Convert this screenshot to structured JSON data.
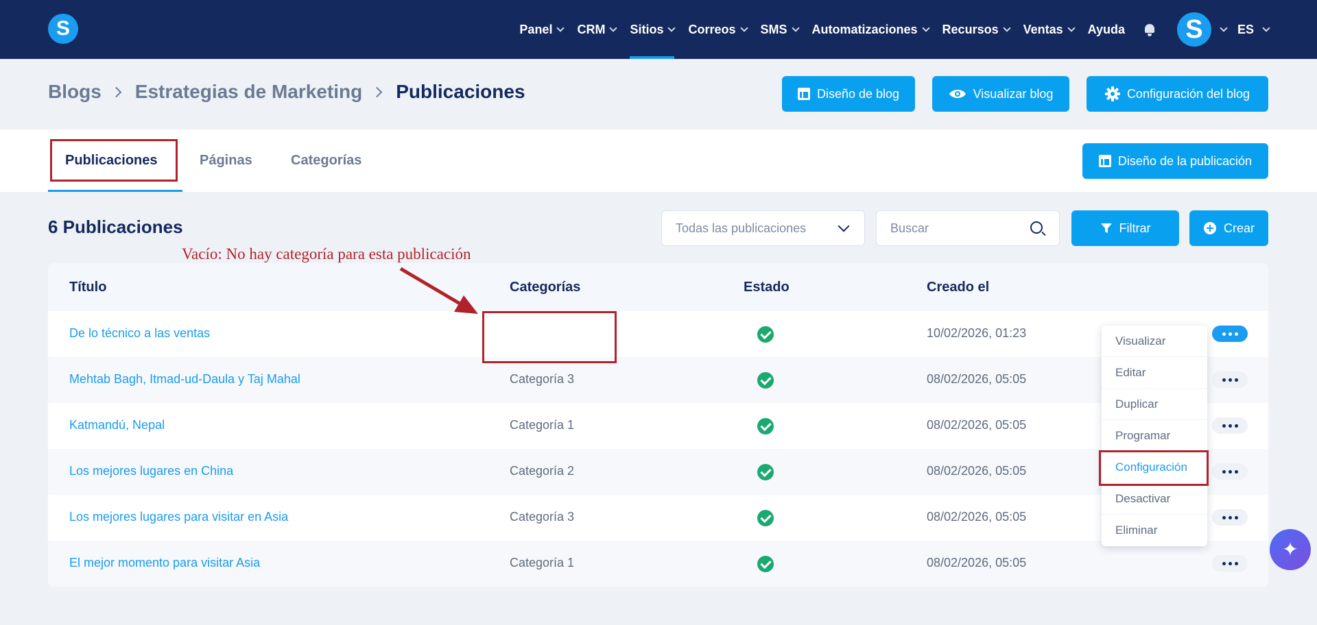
{
  "app": {
    "logo_letter": "S",
    "avatar_letter": "S"
  },
  "nav": {
    "items": [
      {
        "label": "Panel",
        "has_menu": true
      },
      {
        "label": "CRM",
        "has_menu": true
      },
      {
        "label": "Sitios",
        "has_menu": true,
        "active": true
      },
      {
        "label": "Correos",
        "has_menu": true
      },
      {
        "label": "SMS",
        "has_menu": true
      },
      {
        "label": "Automatizaciones",
        "has_menu": true
      },
      {
        "label": "Recursos",
        "has_menu": true
      },
      {
        "label": "Ventas",
        "has_menu": true
      },
      {
        "label": "Ayuda",
        "has_menu": false
      }
    ],
    "language": "ES"
  },
  "breadcrumb": [
    "Blogs",
    "Estrategias de Marketing",
    "Publicaciones"
  ],
  "header_buttons": {
    "design": "Diseño de blog",
    "view": "Visualizar blog",
    "settings": "Configuración del blog"
  },
  "tabs": [
    "Publicaciones",
    "Páginas",
    "Categorías"
  ],
  "post_design_button": "Diseño de la publicación",
  "list": {
    "count_title": "6 Publicaciones",
    "filter_select": "Todas las publicaciones",
    "search_placeholder": "Buscar",
    "filter_button": "Filtrar",
    "create_button": "Crear"
  },
  "table": {
    "headers": [
      "Título",
      "Categorías",
      "Estado",
      "Creado el"
    ],
    "rows": [
      {
        "title": "De lo técnico a las ventas",
        "category": "",
        "status": "published",
        "created": "10/02/2026, 01:23"
      },
      {
        "title": "Mehtab Bagh, Itmad-ud-Daula y Taj Mahal",
        "category": "Categoría 3",
        "status": "published",
        "created": "08/02/2026, 05:05"
      },
      {
        "title": "Katmandú, Nepal",
        "category": "Categoría 1",
        "status": "published",
        "created": "08/02/2026, 05:05"
      },
      {
        "title": "Los mejores lugares en China",
        "category": "Categoría 2",
        "status": "published",
        "created": "08/02/2026, 05:05"
      },
      {
        "title": "Los mejores lugares para visitar en Asia",
        "category": "Categoría 3",
        "status": "published",
        "created": "08/02/2026, 05:05"
      },
      {
        "title": "El mejor momento para visitar Asia",
        "category": "Categoría 1",
        "status": "published",
        "created": "08/02/2026, 05:05"
      }
    ]
  },
  "row_menu": [
    "Visualizar",
    "Editar",
    "Duplicar",
    "Programar",
    "Configuración",
    "Desactivar",
    "Eliminar"
  ],
  "annotation": {
    "text": "Vacío: No hay categoría para esta publicación",
    "color": "#b0232a"
  },
  "colors": {
    "nav_bg": "#14295d",
    "accent": "#0aa0f0",
    "success": "#1aa970"
  }
}
